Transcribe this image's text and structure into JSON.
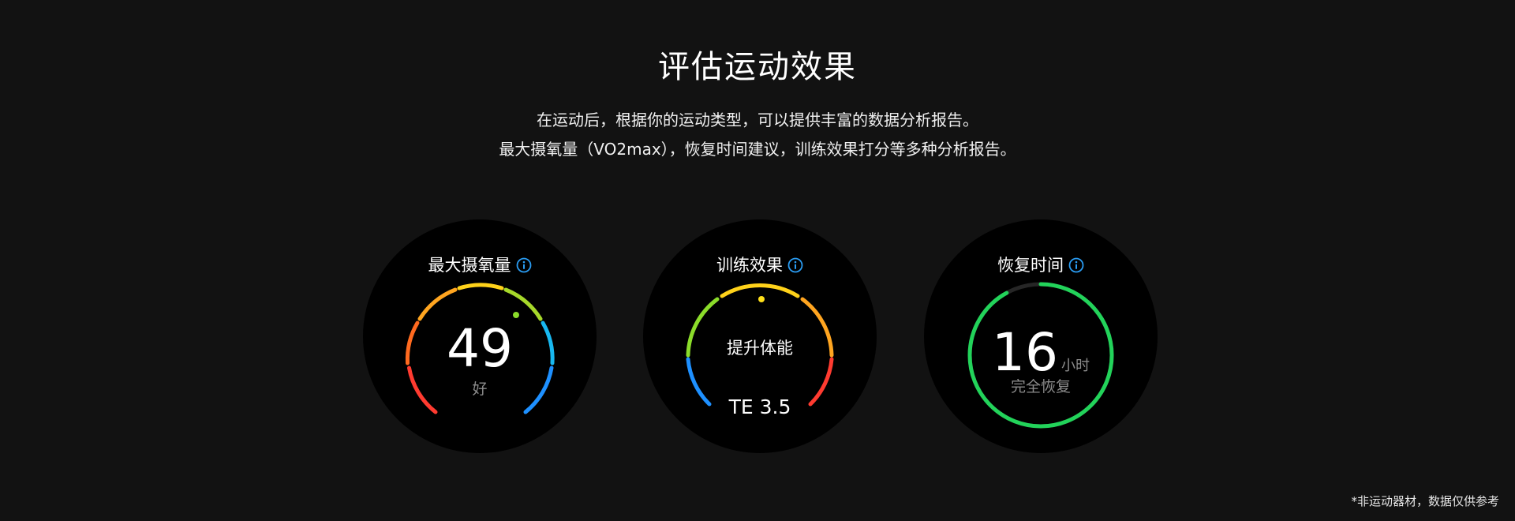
{
  "header": {
    "title": "评估运动效果",
    "desc_line1": "在运动后，根据你的运动类型，可以提供丰富的数据分析报告。",
    "desc_line2": "最大摄氧量（VO2max），恢复时间建议，训练效果打分等多种分析报告。"
  },
  "watches": [
    {
      "title": "最大摄氧量",
      "value": "49",
      "rating": "好",
      "icon": "info-icon"
    },
    {
      "title": "训练效果",
      "label": "提升体能",
      "score": "TE 3.5",
      "icon": "info-icon"
    },
    {
      "title": "恢复时间",
      "value": "16",
      "unit": "小时",
      "status": "完全恢复",
      "icon": "info-icon",
      "progress": 0.92
    }
  ],
  "footnote": "*非运动器材，数据仅供参考",
  "colors": {
    "background": "#121212",
    "watch_face": "#000000",
    "info_icon": "#2a9df4",
    "recovery_green": "#22d35a",
    "gauge": [
      "#ff3b30",
      "#ff7a1f",
      "#ffb020",
      "#ffe01a",
      "#8bdc2a",
      "#18b8f0",
      "#1e90ff"
    ]
  }
}
